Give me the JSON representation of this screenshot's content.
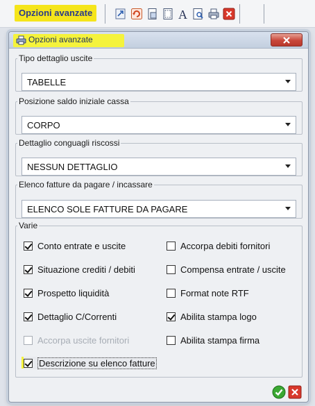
{
  "toolbar": {
    "title": "Opzioni avanzate",
    "icons": [
      "export-icon",
      "refresh-icon",
      "page-setup-icon",
      "page-layout-icon",
      "font-icon",
      "print-preview-icon",
      "printer-icon",
      "close-icon"
    ]
  },
  "dialog": {
    "title": "Opzioni avanzate",
    "groups": [
      {
        "legend": "Tipo dettaglio uscite",
        "value": "TABELLE"
      },
      {
        "legend": "Posizione saldo iniziale cassa",
        "value": "CORPO"
      },
      {
        "legend": "Dettaglio conguagli riscossi",
        "value": "NESSUN DETTAGLIO"
      },
      {
        "legend": "Elenco fatture da pagare / incassare",
        "value": "ELENCO SOLE FATTURE DA PAGARE"
      }
    ],
    "varie": {
      "legend": "Varie",
      "left": [
        {
          "label": "Conto entrate e uscite",
          "checked": true,
          "enabled": true
        },
        {
          "label": "Situazione crediti / debiti",
          "checked": true,
          "enabled": true
        },
        {
          "label": "Prospetto liquidità",
          "checked": true,
          "enabled": true
        },
        {
          "label": "Dettaglio C/Correnti",
          "checked": true,
          "enabled": true
        },
        {
          "label": "Accorpa uscite fornitori",
          "checked": false,
          "enabled": false
        },
        {
          "label": "Descrizione su elenco fatture",
          "checked": true,
          "enabled": true
        }
      ],
      "right": [
        {
          "label": "Accorpa debiti fornitori",
          "checked": false,
          "enabled": true
        },
        {
          "label": "Compensa entrate / uscite",
          "checked": false,
          "enabled": true
        },
        {
          "label": "Format note RTF",
          "checked": false,
          "enabled": true
        },
        {
          "label": "Abilita stampa logo",
          "checked": true,
          "enabled": true
        },
        {
          "label": "Abilita stampa firma",
          "checked": false,
          "enabled": true
        }
      ]
    },
    "colors": {
      "highlight": "#f5f33c",
      "accept": "#3aa832",
      "cancel": "#d8382b"
    }
  }
}
